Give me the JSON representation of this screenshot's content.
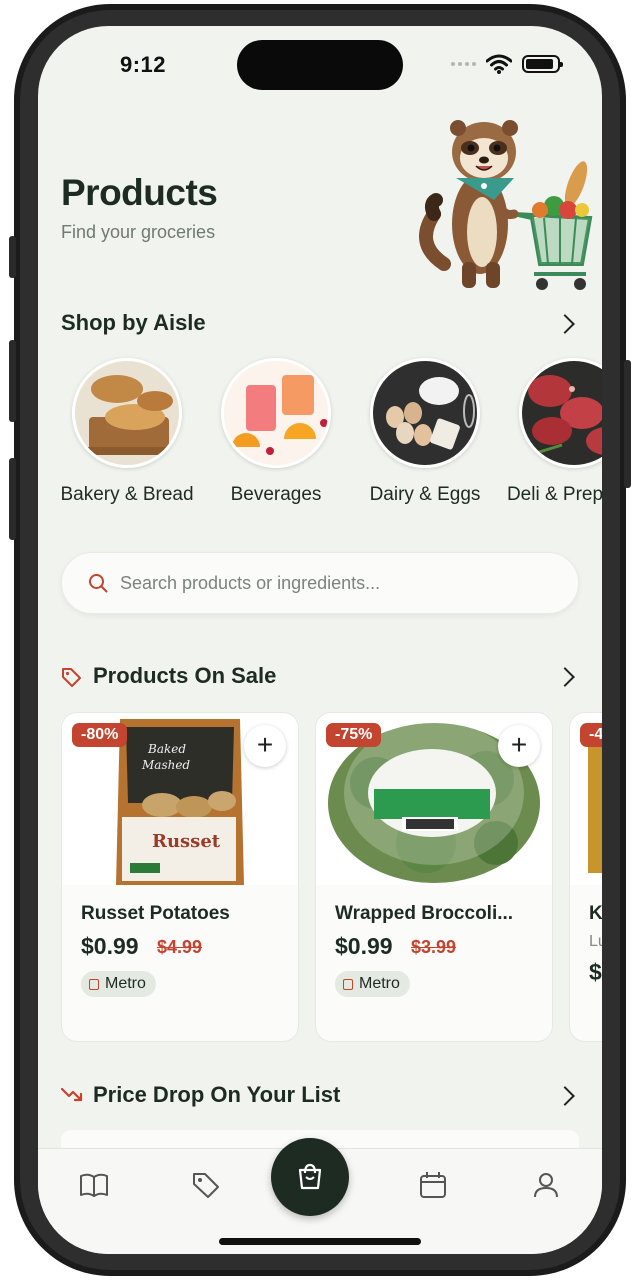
{
  "status_bar": {
    "time": "9:12"
  },
  "header": {
    "title": "Products",
    "subtitle": "Find your groceries"
  },
  "aisles": {
    "title": "Shop by Aisle",
    "items": [
      {
        "label": "Bakery & Bread"
      },
      {
        "label": "Beverages"
      },
      {
        "label": "Dairy & Eggs"
      },
      {
        "label": "Deli & Prepared"
      }
    ]
  },
  "search": {
    "placeholder": "Search products or ingredients..."
  },
  "sale": {
    "title": "Products On Sale",
    "items": [
      {
        "discount": "-80%",
        "name": "Russet Potatoes",
        "price": "$0.99",
        "old_price": "$4.99",
        "store": "Metro"
      },
      {
        "discount": "-75%",
        "name": "Wrapped Broccoli...",
        "price": "$0.99",
        "old_price": "$3.99",
        "store": "Metro"
      },
      {
        "discount": "-4",
        "name": "K",
        "subtitle": "Lu",
        "price": "$"
      }
    ]
  },
  "price_drop": {
    "title": "Price Drop On Your List"
  },
  "colors": {
    "accent": "#c3442f",
    "dark_green": "#1d2b22",
    "background": "#f1f3ee"
  },
  "tabs": [
    {
      "icon": "book-icon"
    },
    {
      "icon": "tag-icon"
    },
    {
      "icon": "shopping-bag-icon"
    },
    {
      "icon": "calendar-icon"
    },
    {
      "icon": "user-icon"
    }
  ]
}
